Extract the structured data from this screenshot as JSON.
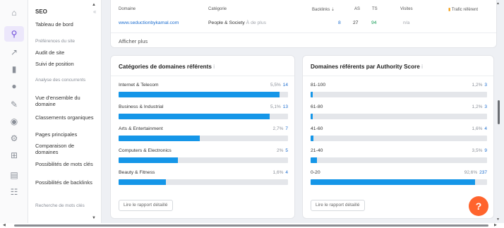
{
  "app": {
    "accent": "#6d4ad9",
    "bar_color": "#1596e8"
  },
  "iconrail": [
    {
      "name": "home-icon",
      "glyph": "⌂"
    },
    {
      "name": "seo-icon",
      "glyph": "⚲"
    },
    {
      "name": "advertising-icon",
      "glyph": "↗"
    },
    {
      "name": "analytics-icon",
      "glyph": "▮"
    },
    {
      "name": "local-icon",
      "glyph": "●"
    },
    {
      "name": "content-icon",
      "glyph": "✎"
    },
    {
      "name": "social-icon",
      "glyph": "◉"
    },
    {
      "name": "ai-icon",
      "glyph": "⚙"
    },
    {
      "name": "apps-icon",
      "glyph": "⊞"
    },
    {
      "name": "reports-icon",
      "glyph": "▤"
    },
    {
      "name": "more-icon",
      "glyph": "☷"
    }
  ],
  "sidebar": {
    "heading": "SEO",
    "items": [
      {
        "label": "Tableau de bord",
        "muted": false
      },
      {
        "label": "Préférences du site",
        "muted": true
      },
      {
        "label": "Audit de site",
        "muted": false
      },
      {
        "label": "Suivi de position",
        "muted": false
      },
      {
        "label": "Analyse des concurrents",
        "muted": true
      },
      {
        "label": "Vue d'ensemble du domaine",
        "muted": false
      },
      {
        "label": "Classements organiques",
        "muted": false
      },
      {
        "label": "Pages principales",
        "muted": false
      },
      {
        "label": "Comparaison de domaines",
        "muted": false
      },
      {
        "label": "Possibilités de mots clés",
        "muted": false
      },
      {
        "label": "Possibilités de backlinks",
        "muted": false
      },
      {
        "label": "Recherche de mots clés",
        "muted": true
      }
    ]
  },
  "table": {
    "headers": {
      "domain": "Domaine",
      "category": "Catégorie",
      "backlinks": "Backlinks ⇣",
      "as": "AS",
      "ts": "TS",
      "visits": "Visites",
      "traffic": "Trafic référent"
    },
    "row": {
      "domain": "www.seductionbykamal.com",
      "category": "People & Society",
      "category_more": "À de plus",
      "backlinks": "8",
      "as": "27",
      "ts": "94",
      "visits": "n/a"
    },
    "show_more": "Afficher plus"
  },
  "categories_card": {
    "title": "Catégories de domaines référents",
    "info": "i",
    "rows": [
      {
        "label": "Internet & Telecom",
        "pct": "5,5%",
        "count": "14",
        "fill": 0.95
      },
      {
        "label": "Business & Industrial",
        "pct": "5,1%",
        "count": "13",
        "fill": 0.89
      },
      {
        "label": "Arts & Entertainment",
        "pct": "2,7%",
        "count": "7",
        "fill": 0.48
      },
      {
        "label": "Computers & Electronics",
        "pct": "2%",
        "count": "5",
        "fill": 0.35
      },
      {
        "label": "Beauty & Fitness",
        "pct": "1,6%",
        "count": "4",
        "fill": 0.28
      }
    ],
    "report": "Lire le rapport détaillé"
  },
  "authority_card": {
    "title": "Domaines référents par Authority Score",
    "info": "i",
    "rows": [
      {
        "label": "81-100",
        "pct": "1,2%",
        "count": "3",
        "fill": 0.013
      },
      {
        "label": "61-80",
        "pct": "1,2%",
        "count": "3",
        "fill": 0.013
      },
      {
        "label": "41-60",
        "pct": "1,6%",
        "count": "4",
        "fill": 0.017
      },
      {
        "label": "21-40",
        "pct": "3,5%",
        "count": "9",
        "fill": 0.037
      },
      {
        "label": "0-20",
        "pct": "92,6%",
        "count": "237",
        "fill": 0.93
      }
    ],
    "report": "Lire le rapport détaillé"
  },
  "help": {
    "label": "?"
  }
}
